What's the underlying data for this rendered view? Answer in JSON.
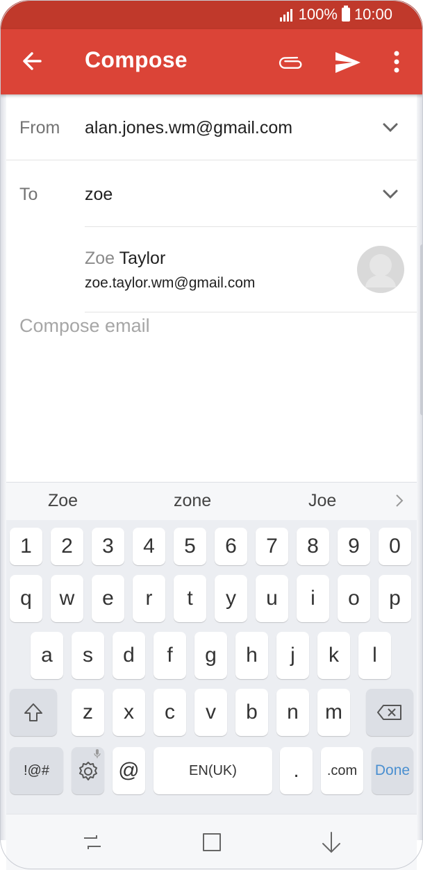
{
  "status": {
    "battery": "100%",
    "time": "10:00"
  },
  "appbar": {
    "title": "Compose"
  },
  "from": {
    "label": "From",
    "value": "alan.jones.wm@gmail.com"
  },
  "to": {
    "label": "To",
    "value": "zoe"
  },
  "suggestion": {
    "typed": "Zoe",
    "rest": " Taylor",
    "email": "zoe.taylor.wm@gmail.com"
  },
  "body": {
    "placeholder": "Compose email"
  },
  "keyboard": {
    "suggestions": [
      "Zoe",
      "zone",
      "Joe"
    ],
    "numbers": [
      "1",
      "2",
      "3",
      "4",
      "5",
      "6",
      "7",
      "8",
      "9",
      "0"
    ],
    "row1": [
      "q",
      "w",
      "e",
      "r",
      "t",
      "y",
      "u",
      "i",
      "o",
      "p"
    ],
    "row2": [
      "a",
      "s",
      "d",
      "f",
      "g",
      "h",
      "j",
      "k",
      "l"
    ],
    "row3": [
      "z",
      "x",
      "c",
      "v",
      "b",
      "n",
      "m"
    ],
    "symbols": "!@#",
    "at": "@",
    "space": "EN(UK)",
    "period": ".",
    "dotcom": ".com",
    "done": "Done"
  },
  "colors": {
    "status_bar": "#c0392b",
    "app_bar": "#db4437",
    "done": "#4a8fd0"
  }
}
